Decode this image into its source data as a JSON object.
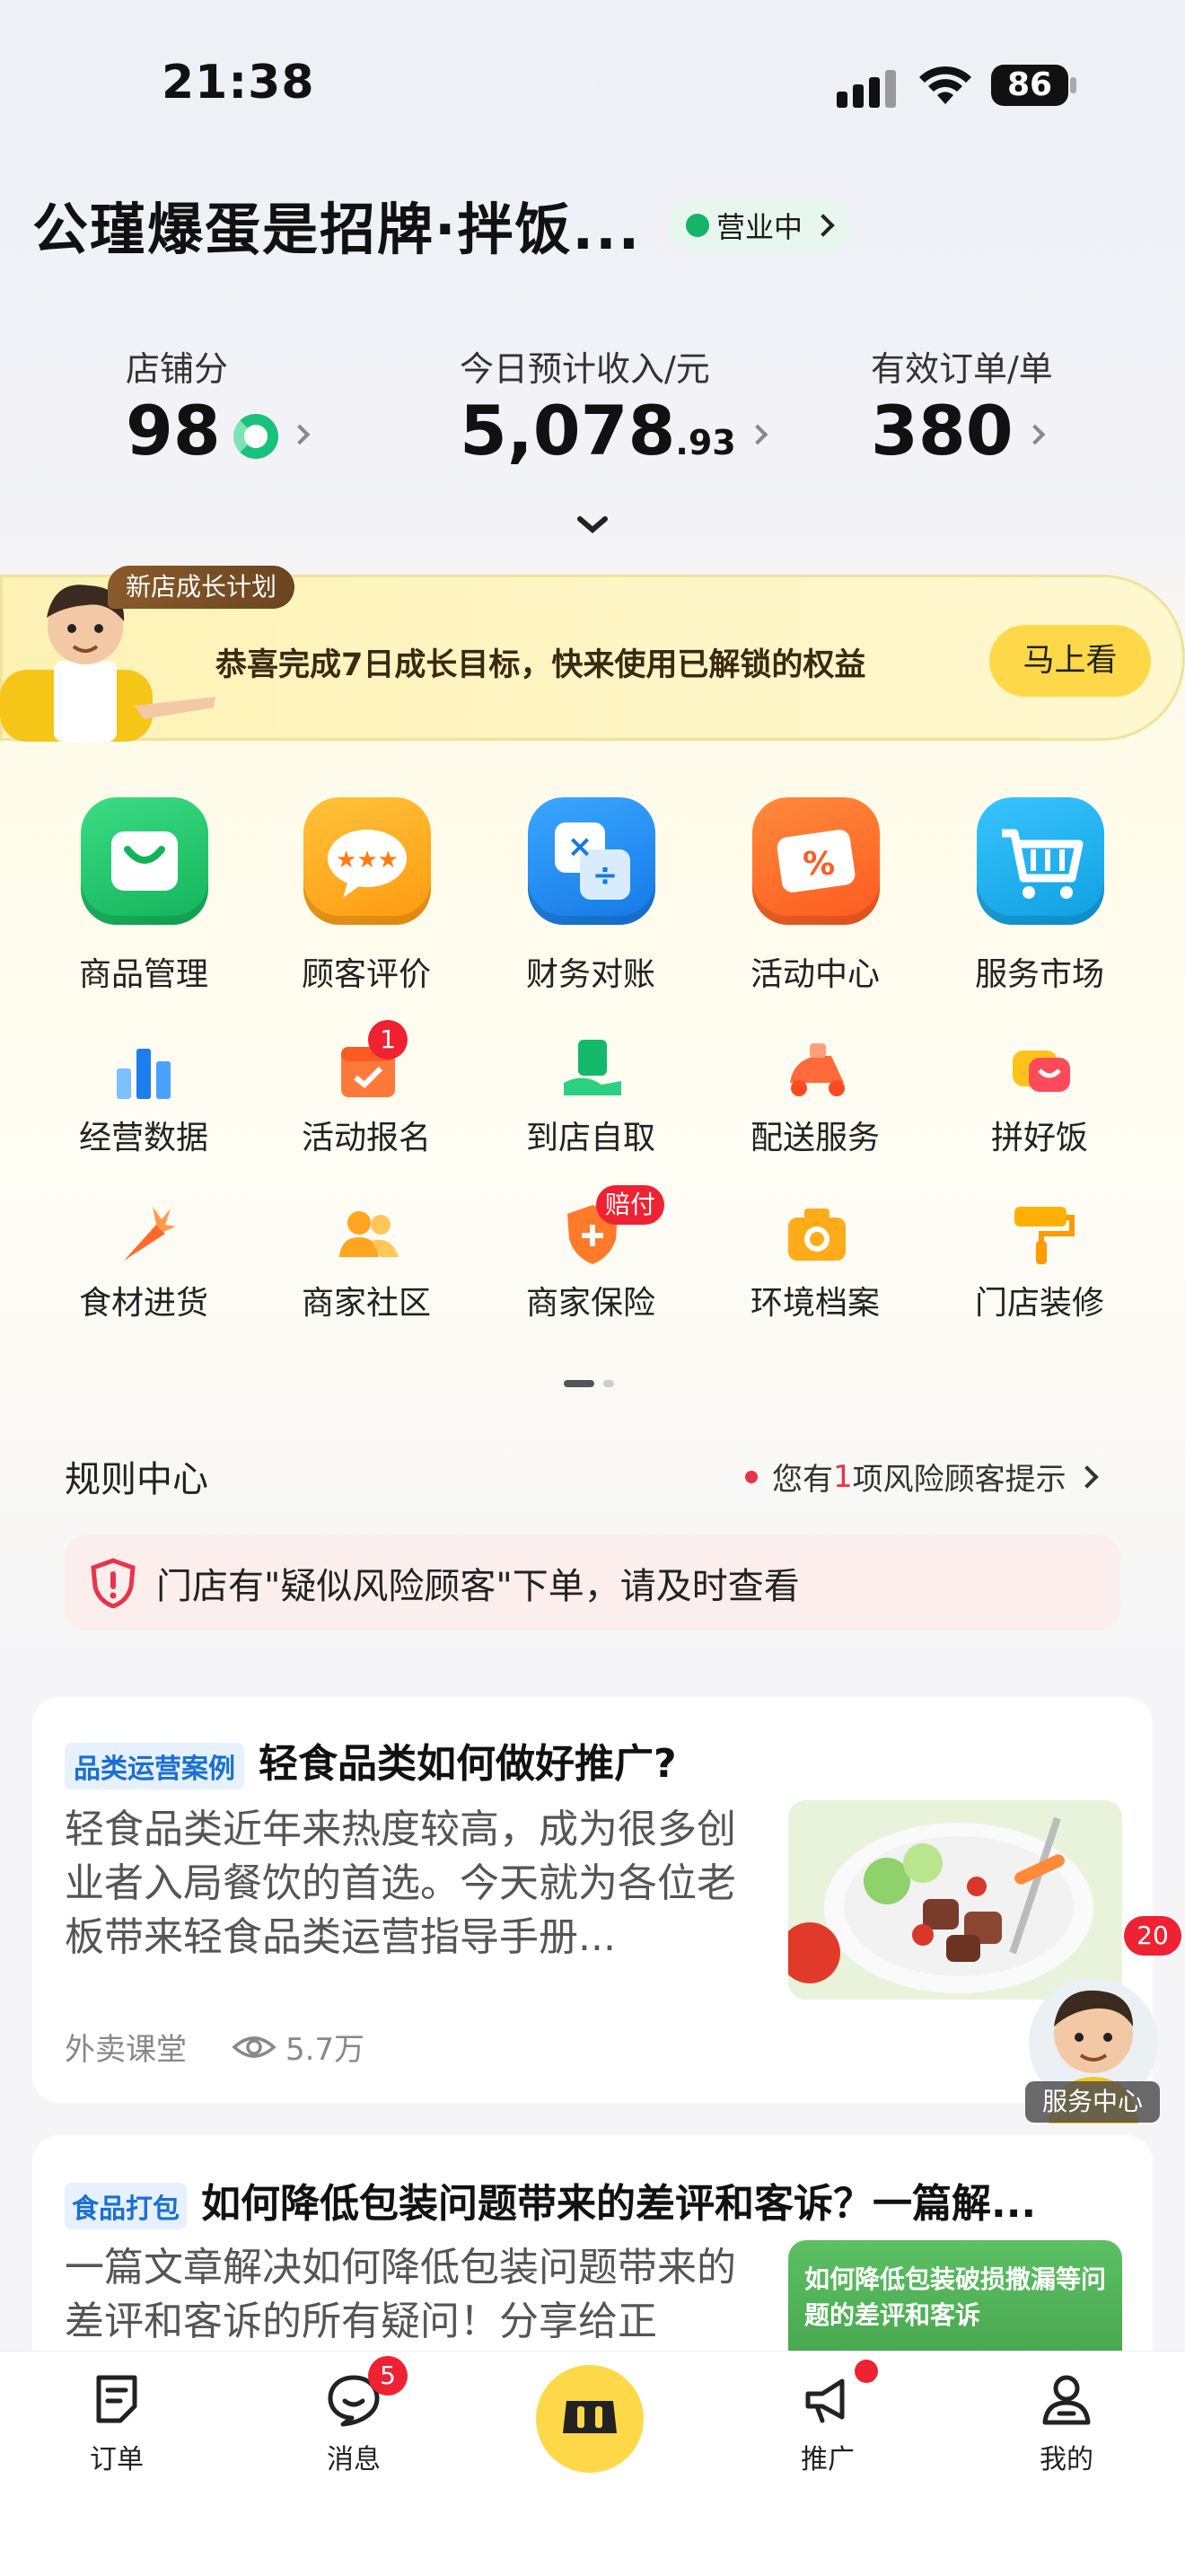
{
  "status_bar": {
    "time": "21:38",
    "battery": "86"
  },
  "store": {
    "name": "公瑾爆蛋是招牌·拌饭...",
    "status": "营业中"
  },
  "metrics": [
    {
      "label": "店铺分",
      "value": "98",
      "decimal": ""
    },
    {
      "label": "今日预计收入/元",
      "value": "5,078",
      "decimal": ".93"
    },
    {
      "label": "有效订单/单",
      "value": "380",
      "decimal": ""
    }
  ],
  "banner": {
    "tag": "新店成长计划",
    "text": "恭喜完成7日成长目标，快来使用已解锁的权益",
    "button": "马上看"
  },
  "main_grid": [
    {
      "label": "商品管理",
      "icon": "shopping-bag-icon",
      "color": "#22c36a"
    },
    {
      "label": "顾客评价",
      "icon": "rating-chat-icon",
      "color": "#ffa51f"
    },
    {
      "label": "财务对账",
      "icon": "calculator-icon",
      "color": "#1f8ff0"
    },
    {
      "label": "活动中心",
      "icon": "coupon-percent-icon",
      "color": "#ff6a2a"
    },
    {
      "label": "服务市场",
      "icon": "cart-icon",
      "color": "#16a9e8"
    }
  ],
  "tools_row1": [
    {
      "label": "经营数据",
      "icon": "bar-chart-icon"
    },
    {
      "label": "活动报名",
      "icon": "calendar-check-icon",
      "badge": "1"
    },
    {
      "label": "到店自取",
      "icon": "pickup-hand-icon"
    },
    {
      "label": "配送服务",
      "icon": "scooter-icon"
    },
    {
      "label": "拼好饭",
      "icon": "meal-box-icon"
    }
  ],
  "tools_row2": [
    {
      "label": "食材进货",
      "icon": "carrot-icon"
    },
    {
      "label": "商家社区",
      "icon": "people-icon"
    },
    {
      "label": "商家保险",
      "icon": "shield-plus-icon",
      "badge": "赔付"
    },
    {
      "label": "环境档案",
      "icon": "camera-icon"
    },
    {
      "label": "门店装修",
      "icon": "paint-roller-icon"
    }
  ],
  "rules": {
    "title": "规则中心",
    "link_prefix": "您有",
    "link_count": "1",
    "link_suffix": "项风险顾客提示",
    "alert": "门店有\"疑似风险顾客\"下单，请及时查看"
  },
  "articles": [
    {
      "tag": "品类运营案例",
      "title": "轻食品类如何做好推广?",
      "body": "轻食品类近年来热度较高，成为很多创业者入局餐饮的首选。今天就为各位老板带来轻食品类运营指导手册...",
      "source": "外卖课堂",
      "views": "5.7万"
    },
    {
      "tag": "食品打包",
      "title": "如何降低包装问题带来的差评和客诉？一篇解...",
      "body": "一篇文章解决如何降低包装问题带来的差评和客诉的所有疑问！分享给正",
      "image_text": "如何降低包装破损撒漏等问题的差评和客诉"
    }
  ],
  "service_center": {
    "label": "服务中心",
    "badge": "20"
  },
  "tabbar": [
    {
      "label": "订单",
      "icon": "order-list-icon"
    },
    {
      "label": "消息",
      "icon": "chat-bubble-icon",
      "badge": "5"
    },
    {
      "label": "",
      "icon": "store-icon"
    },
    {
      "label": "推广",
      "icon": "megaphone-icon"
    },
    {
      "label": "我的",
      "icon": "person-icon"
    }
  ],
  "colors": {
    "accent_yellow": "#ffd84a",
    "status_green": "#16b36b",
    "alert_red": "#e8344a"
  }
}
